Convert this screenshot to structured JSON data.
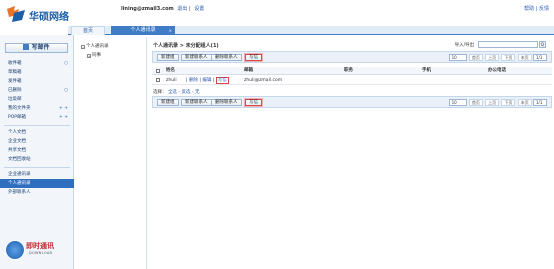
{
  "brand": {
    "name": "华硕网络"
  },
  "user": {
    "email": "lining@zmail3.com",
    "links": [
      "退出",
      "设置"
    ]
  },
  "top_links": [
    "帮助",
    "反馈"
  ],
  "tabs": [
    {
      "label": "首页"
    },
    {
      "label": "个人通讯录",
      "close": "×"
    }
  ],
  "sidebar": {
    "write_label": "写邮件",
    "items": [
      {
        "label": "收件箱",
        "action": "○"
      },
      {
        "label": "草稿箱"
      },
      {
        "label": "发件箱"
      },
      {
        "label": "已删除",
        "action": "○"
      },
      {
        "label": "垃圾邮"
      },
      {
        "label": "我的文件夹",
        "action": "+ +"
      },
      {
        "label": "POP邮箱",
        "action": "+ +"
      },
      {
        "label": "个人文档"
      },
      {
        "label": "企业文档"
      },
      {
        "label": "共享文档"
      },
      {
        "label": "文档回收站"
      },
      {
        "label": "企业通讯录"
      },
      {
        "label": "个人通讯录",
        "selected": true
      },
      {
        "label": "外部联系人"
      }
    ]
  },
  "promo": {
    "title": "即时通讯",
    "subtitle": "DOWNLOAD"
  },
  "tree": [
    {
      "label": "个人通讯录",
      "expander": "−"
    },
    {
      "label": "同事",
      "expander": "+"
    }
  ],
  "main": {
    "title": "个人通讯录 > 未分配组人(1)",
    "import_label": "导入/导出",
    "search_button": "Q",
    "toolbar_buttons": [
      "新建组",
      "新建联系人",
      "删除联系人",
      "写信"
    ],
    "page_size": "10",
    "pager": [
      "首页",
      "上页",
      "下页",
      "末页"
    ],
    "page_index": "1/1",
    "columns": [
      "姓名",
      "邮箱",
      "职务",
      "手机",
      "办公电话"
    ],
    "rows": [
      {
        "name": "zhuli",
        "ops": [
          "删除",
          "编辑",
          "写信"
        ],
        "email": "zhuli@zmail.com",
        "job": "",
        "mobile": "",
        "phone": ""
      }
    ],
    "select_label": "选择：",
    "select_options": [
      "全选",
      "反选",
      "无"
    ]
  }
}
